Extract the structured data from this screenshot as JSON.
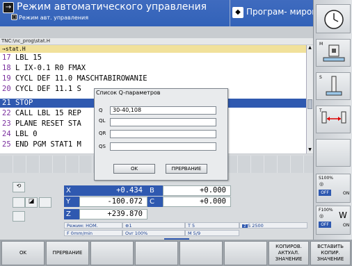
{
  "header": {
    "mode_title": "Режим автоматического управления",
    "mode_subtitle": "Режим авт. управления",
    "second_mode": "Програм- мирован…"
  },
  "program": {
    "path": "TNC:\\nc_prog\\stat.H",
    "file_line": "→stat.H",
    "lines": [
      {
        "num": "17",
        "text": " LBL 15"
      },
      {
        "num": "18",
        "text": " L IX-0.1 R0 FMAX"
      },
      {
        "num": "19",
        "text": " CYCL DEF 11.0 MASCHTABIROWANIE"
      },
      {
        "num": "20",
        "text": " CYCL DEF 11.1 S"
      },
      {
        "num": "21",
        "text": " STOP"
      },
      {
        "num": "22",
        "text": " CALL LBL 15 REP"
      },
      {
        "num": "23",
        "text": " PLANE RESET STA"
      },
      {
        "num": "24",
        "text": " LBL 0"
      },
      {
        "num": "25",
        "text": " END PGM STAT1 M"
      }
    ]
  },
  "dialog": {
    "title": "Список Q-параметров",
    "fields": [
      {
        "label": "Q",
        "value": "30-40,108"
      },
      {
        "label": "QL",
        "value": ""
      },
      {
        "label": "QR",
        "value": ""
      },
      {
        "label": "QS",
        "value": ""
      }
    ],
    "ok_label": "OK",
    "cancel_label": "ПРЕРВАНИЕ"
  },
  "axes": [
    {
      "axis": "X",
      "value": "+0.434"
    },
    {
      "axis": "B",
      "value": "+0.000"
    },
    {
      "axis": "Y",
      "value": "-100.072"
    },
    {
      "axis": "C",
      "value": "+0.000"
    },
    {
      "axis": "Z",
      "value": "+239.870"
    }
  ],
  "status_info": {
    "mode": "Режим: НОМ.",
    "spindle": "1",
    "tool": "T 5",
    "speed": "S 2500",
    "feed": "F 0mm/min",
    "override": "Ovr 100%",
    "mfunc": "M 5/9"
  },
  "right_softkeys": {
    "m_label": "M",
    "s_label": "S",
    "t_label": "T",
    "s_override": "S100%",
    "f_override": "F100%",
    "off1": "OFF",
    "on1": "ON",
    "off2": "OFF",
    "on2": "ON"
  },
  "bottom_softkeys": [
    {
      "label": "OK"
    },
    {
      "label": "ПРЕРВАНИЕ"
    },
    {
      "label": ""
    },
    {
      "label": ""
    },
    {
      "label": ""
    },
    {
      "label": ""
    },
    {
      "label": "КОПИРОВ.\nАКТУАЛ.\nЗНАЧЕНИЕ"
    },
    {
      "label": "ВСТАВИТЬ\nКОПИР.\nЗНАЧЕНИЕ"
    }
  ],
  "colors": {
    "header_blue": "#3262b8",
    "highlight_blue": "#2f59b0",
    "line_number_purple": "#7a2e9e",
    "off_blue": "#2f59b0"
  }
}
